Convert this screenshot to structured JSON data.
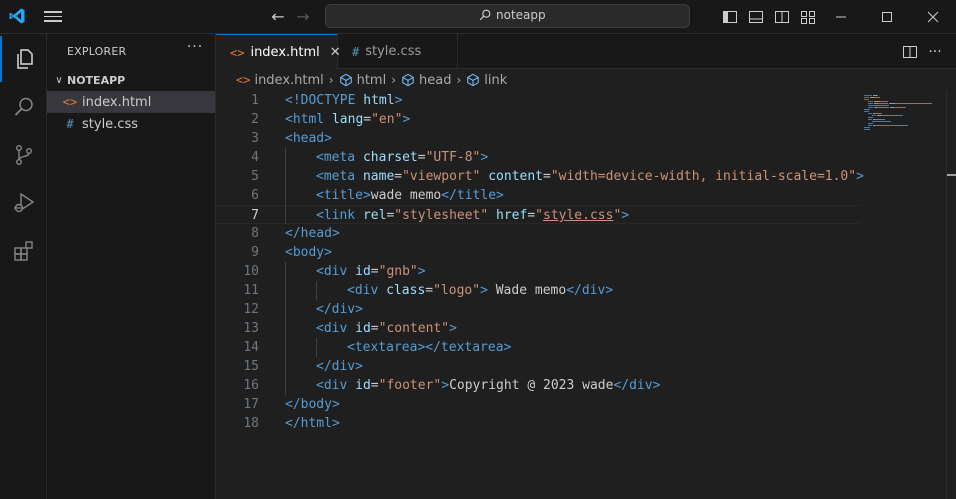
{
  "titlebar": {
    "search_text": "noteapp"
  },
  "sidebar": {
    "header": "EXPLORER",
    "more": "···",
    "folder": "NOTEAPP",
    "files": [
      {
        "label": "index.html",
        "icon": "<>",
        "icon_color": "#e37933"
      },
      {
        "label": "style.css",
        "icon": "#",
        "icon_color": "#519aba"
      }
    ]
  },
  "tabs": [
    {
      "label": "index.html",
      "icon": "<>",
      "icon_color": "#e37933",
      "close": "✕"
    },
    {
      "label": "style.css",
      "icon": "#",
      "icon_color": "#519aba"
    }
  ],
  "breadcrumb": [
    "index.html",
    "html",
    "head",
    "link"
  ],
  "editor": {
    "current_line": 7,
    "lines": [
      {
        "n": "1",
        "indent": 0,
        "tokens": [
          [
            "t-tag",
            "<!DOCTYPE"
          ],
          [
            "t-txt",
            " "
          ],
          [
            "t-attr",
            "html"
          ],
          [
            "t-tag",
            ">"
          ]
        ]
      },
      {
        "n": "2",
        "indent": 0,
        "tokens": [
          [
            "t-tag",
            "<html"
          ],
          [
            "t-txt",
            " "
          ],
          [
            "t-attr",
            "lang"
          ],
          [
            "t-txt",
            "="
          ],
          [
            "t-str",
            "\"en\""
          ],
          [
            "t-tag",
            ">"
          ]
        ]
      },
      {
        "n": "3",
        "indent": 0,
        "tokens": [
          [
            "t-tag",
            "<head>"
          ]
        ]
      },
      {
        "n": "4",
        "indent": 1,
        "tokens": [
          [
            "t-tag",
            "<meta"
          ],
          [
            "t-txt",
            " "
          ],
          [
            "t-attr",
            "charset"
          ],
          [
            "t-txt",
            "="
          ],
          [
            "t-str",
            "\"UTF-8\""
          ],
          [
            "t-tag",
            ">"
          ]
        ]
      },
      {
        "n": "5",
        "indent": 1,
        "tokens": [
          [
            "t-tag",
            "<meta"
          ],
          [
            "t-txt",
            " "
          ],
          [
            "t-attr",
            "name"
          ],
          [
            "t-txt",
            "="
          ],
          [
            "t-str",
            "\"viewport\""
          ],
          [
            "t-txt",
            " "
          ],
          [
            "t-attr",
            "content"
          ],
          [
            "t-txt",
            "="
          ],
          [
            "t-str",
            "\"width=device-width, initial-scale=1.0\""
          ],
          [
            "t-tag",
            ">"
          ]
        ]
      },
      {
        "n": "6",
        "indent": 1,
        "tokens": [
          [
            "t-tag",
            "<title>"
          ],
          [
            "t-txt",
            "wade memo"
          ],
          [
            "t-tag",
            "</title>"
          ]
        ]
      },
      {
        "n": "7",
        "indent": 1,
        "tokens": [
          [
            "t-tag",
            "<link"
          ],
          [
            "t-txt",
            " "
          ],
          [
            "t-attr",
            "rel"
          ],
          [
            "t-txt",
            "="
          ],
          [
            "t-str",
            "\"stylesheet\""
          ],
          [
            "t-txt",
            " "
          ],
          [
            "t-attr",
            "href"
          ],
          [
            "t-txt",
            "="
          ],
          [
            "t-str",
            "\""
          ],
          [
            "t-str t-link",
            "style.css"
          ],
          [
            "t-str",
            "\""
          ],
          [
            "t-tag",
            ">"
          ]
        ]
      },
      {
        "n": "8",
        "indent": 0,
        "tokens": [
          [
            "t-tag",
            "</head>"
          ]
        ]
      },
      {
        "n": "9",
        "indent": 0,
        "tokens": [
          [
            "t-tag",
            "<body>"
          ]
        ]
      },
      {
        "n": "10",
        "indent": 1,
        "tokens": [
          [
            "t-tag",
            "<div"
          ],
          [
            "t-txt",
            " "
          ],
          [
            "t-attr",
            "id"
          ],
          [
            "t-txt",
            "="
          ],
          [
            "t-str",
            "\"gnb\""
          ],
          [
            "t-tag",
            ">"
          ]
        ]
      },
      {
        "n": "11",
        "indent": 2,
        "tokens": [
          [
            "t-tag",
            "<div"
          ],
          [
            "t-txt",
            " "
          ],
          [
            "t-attr",
            "class"
          ],
          [
            "t-txt",
            "="
          ],
          [
            "t-str",
            "\"logo\""
          ],
          [
            "t-tag",
            ">"
          ],
          [
            "t-txt",
            " Wade memo"
          ],
          [
            "t-tag",
            "</div>"
          ]
        ]
      },
      {
        "n": "12",
        "indent": 1,
        "tokens": [
          [
            "t-tag",
            "</div>"
          ]
        ]
      },
      {
        "n": "13",
        "indent": 1,
        "tokens": [
          [
            "t-tag",
            "<div"
          ],
          [
            "t-txt",
            " "
          ],
          [
            "t-attr",
            "id"
          ],
          [
            "t-txt",
            "="
          ],
          [
            "t-str",
            "\"content\""
          ],
          [
            "t-tag",
            ">"
          ]
        ]
      },
      {
        "n": "14",
        "indent": 2,
        "tokens": [
          [
            "t-tag",
            "<textarea></textarea>"
          ]
        ]
      },
      {
        "n": "15",
        "indent": 1,
        "tokens": [
          [
            "t-tag",
            "</div>"
          ]
        ]
      },
      {
        "n": "16",
        "indent": 1,
        "tokens": [
          [
            "t-tag",
            "<div"
          ],
          [
            "t-txt",
            " "
          ],
          [
            "t-attr",
            "id"
          ],
          [
            "t-txt",
            "="
          ],
          [
            "t-str",
            "\"footer\""
          ],
          [
            "t-tag",
            ">"
          ],
          [
            "t-txt",
            "Copyright @ 2023 wade"
          ],
          [
            "t-tag",
            "</div>"
          ]
        ]
      },
      {
        "n": "17",
        "indent": 0,
        "tokens": [
          [
            "t-tag",
            "</body>"
          ]
        ]
      },
      {
        "n": "18",
        "indent": 0,
        "tokens": [
          [
            "t-tag",
            "</html>"
          ]
        ]
      }
    ]
  },
  "colors": {
    "accent": "#0078d4",
    "vscode_logo": "#23a9f2"
  },
  "icons": {
    "activity": [
      "explorer-icon",
      "search-icon",
      "source-control-icon",
      "run-debug-icon",
      "extensions-icon"
    ]
  }
}
